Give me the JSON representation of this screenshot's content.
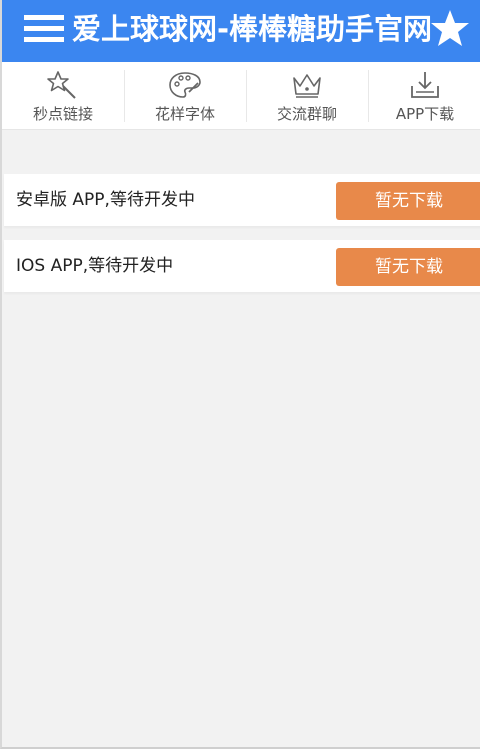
{
  "header": {
    "title": "爱上球球网-棒棒糖助手官网",
    "menu_icon": "hamburger-menu-icon",
    "favorite_icon": "star-icon",
    "bg_color": "#3b86f0"
  },
  "nav": {
    "items": [
      {
        "label": "秒点链接",
        "icon": "magic-wand-icon"
      },
      {
        "label": "花样字体",
        "icon": "palette-icon"
      },
      {
        "label": "交流群聊",
        "icon": "crown-icon"
      },
      {
        "label": "APP下载",
        "icon": "download-icon"
      }
    ]
  },
  "apps": [
    {
      "name": "安卓版 APP,等待开发中",
      "button_label": "暂无下载"
    },
    {
      "name": "IOS APP,等待开发中",
      "button_label": "暂无下载"
    }
  ],
  "colors": {
    "button": "#e8894a",
    "page_bg": "#f2f2f2"
  }
}
